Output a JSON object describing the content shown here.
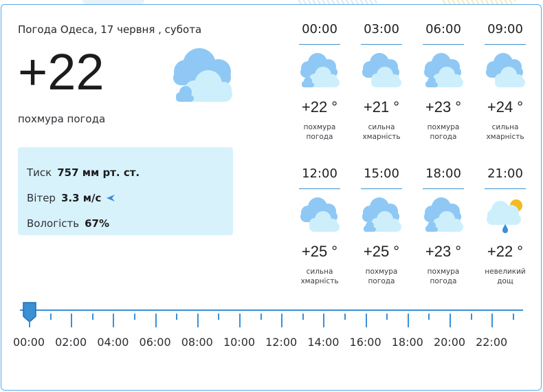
{
  "header": {
    "city_date": "Погода Одеса, 17 червня , субота",
    "temperature": "+22",
    "condition": "похмура погода",
    "icon": "cloudy-icon"
  },
  "details": {
    "pressure_label": "Тиск",
    "pressure_value": "757 мм рт. ст.",
    "wind_label": "Вітер",
    "wind_value": "3.3 м/с",
    "humidity_label": "Вологість",
    "humidity_value": "67%"
  },
  "hourly": [
    {
      "time": "00:00",
      "temp": "+22 °",
      "desc": "похмура\nпогода",
      "icon": "cloudy-icon"
    },
    {
      "time": "03:00",
      "temp": "+21 °",
      "desc": "сильна\nхмарність",
      "icon": "overcast-icon"
    },
    {
      "time": "06:00",
      "temp": "+23 °",
      "desc": "похмура\nпогода",
      "icon": "cloudy-icon"
    },
    {
      "time": "09:00",
      "temp": "+24 °",
      "desc": "сильна\nхмарність",
      "icon": "overcast-icon"
    },
    {
      "time": "12:00",
      "temp": "+25 °",
      "desc": "сильна\nхмарність",
      "icon": "overcast-icon"
    },
    {
      "time": "15:00",
      "temp": "+25 °",
      "desc": "похмура\nпогода",
      "icon": "cloudy-icon"
    },
    {
      "time": "18:00",
      "temp": "+23 °",
      "desc": "похмура\nпогода",
      "icon": "cloudy-icon"
    },
    {
      "time": "21:00",
      "temp": "+22 °",
      "desc": "невеликий\nдощ",
      "icon": "light-rain-icon"
    }
  ],
  "timeline": {
    "labels": [
      "00:00",
      "02:00",
      "04:00",
      "06:00",
      "08:00",
      "10:00",
      "12:00",
      "14:00",
      "16:00",
      "18:00",
      "20:00",
      "22:00"
    ],
    "selected_hour": 0
  },
  "colors": {
    "accent": "#3a8fd5",
    "panel": "#d8f2fc",
    "cloud_dark": "#8fc8f4",
    "cloud_light": "#cdeffc"
  }
}
